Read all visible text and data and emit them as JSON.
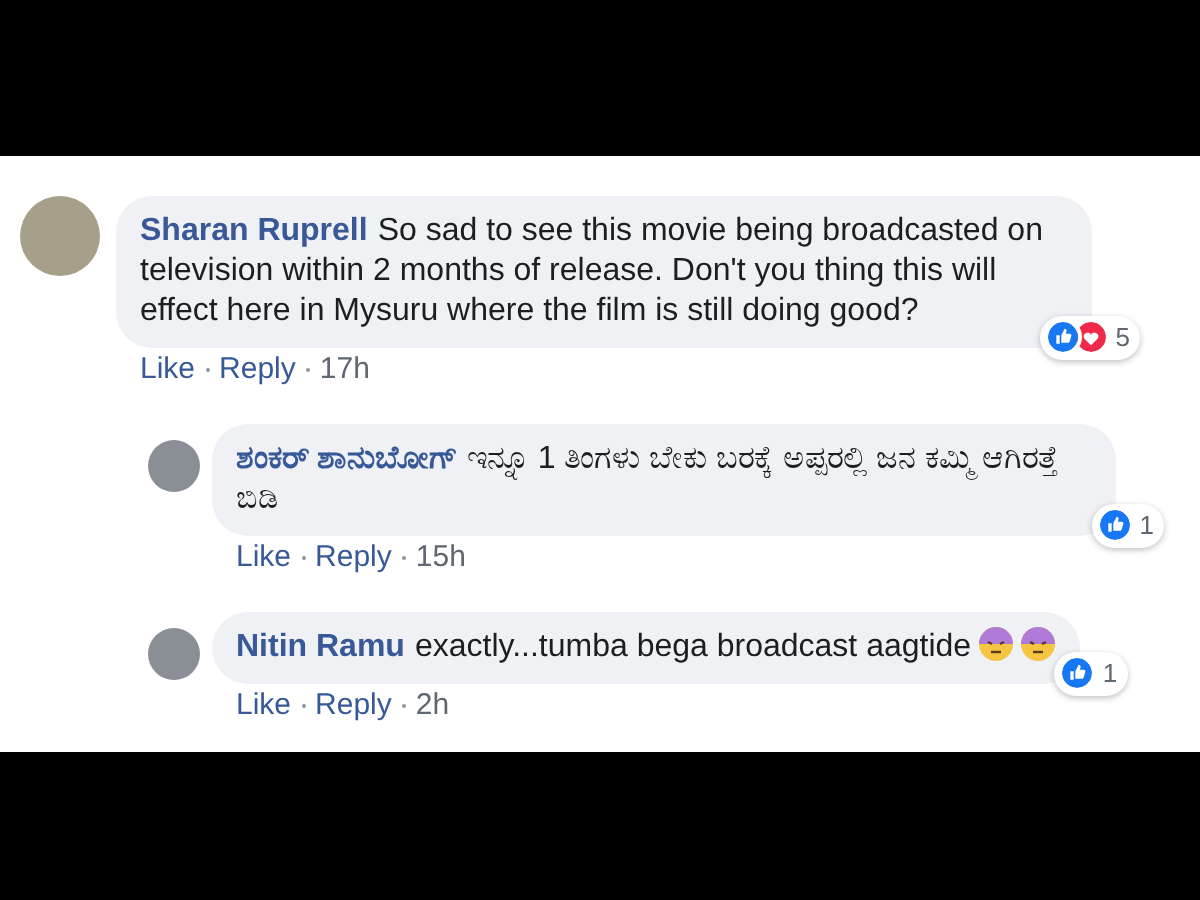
{
  "comments": [
    {
      "author": "Sharan Ruprell",
      "text": "So sad to see this movie being broadcasted on television within 2 months of release. Don't you thing this will effect here in Mysuru where the film is still doing good?",
      "reply": false,
      "reactions": [
        {
          "kind": "like"
        },
        {
          "kind": "love"
        }
      ],
      "reaction_count": "5",
      "actions": [
        "Like",
        "Reply",
        "17h"
      ]
    },
    {
      "author": "ಶಂಕರ್ ಶಾನುಬೋಗ್",
      "text": "ಇನ್ನೂ 1 ತಿಂಗಳು ಬೇಕು ಬರಕ್ಕೆ ಅಪ್ಪರಲ್ಲಿ ಜನ ಕಮ್ಮಿ ಆಗಿರತ್ತೆ ಬಿಡಿ",
      "reply": true,
      "reactions": [
        {
          "kind": "like"
        }
      ],
      "reaction_count": "1",
      "actions": [
        "Like",
        "Reply",
        "15h"
      ]
    },
    {
      "author": "Nitin Ramu",
      "text": "exactly...tumba bega broadcast aagtide",
      "reply": true,
      "emojis": [
        {
          "kind": "face"
        },
        {
          "kind": "face"
        }
      ],
      "reactions": [
        {
          "kind": "like"
        }
      ],
      "reaction_count": "1",
      "actions": [
        "Like",
        "Reply",
        "2h"
      ]
    }
  ]
}
